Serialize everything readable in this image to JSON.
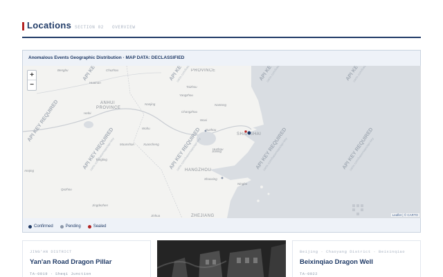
{
  "header": {
    "title": "Locations",
    "section_label": "SECTION 02",
    "section_sublabel": "OVERVIEW"
  },
  "map": {
    "caption": "Anomalous Events Geographic Distribution · MAP DATA: DECLASSIFIED",
    "zoom_in": "+",
    "zoom_out": "−",
    "watermark": "API KEY REQUIRED",
    "watermark_sub": "carto.com/basemaps/api-key",
    "attribution": "Leaflet | © CARTO",
    "place_labels": [
      {
        "text": "PROVINCE"
      },
      {
        "text": "ANHUI"
      },
      {
        "text": "PROVINCE"
      },
      {
        "text": "HANGZHOU"
      },
      {
        "text": "ZHEJIANG"
      },
      {
        "text": "SHANGHAI"
      },
      {
        "text": "Nanjing"
      },
      {
        "text": "Wuxi"
      },
      {
        "text": "Suzhou"
      },
      {
        "text": "Ningbo"
      },
      {
        "text": "Huainan"
      },
      {
        "text": "Hefei"
      },
      {
        "text": "Changzhou"
      },
      {
        "text": "Nantong"
      },
      {
        "text": "Wuhu"
      },
      {
        "text": "Jiaxing"
      },
      {
        "text": "Shaoxing"
      },
      {
        "text": "Anqing"
      },
      {
        "text": "Yangzhou"
      },
      {
        "text": "Taizhou"
      },
      {
        "text": "Bengbu"
      },
      {
        "text": "Chuzhou"
      },
      {
        "text": "Maanshan"
      },
      {
        "text": "Xuancheng"
      },
      {
        "text": "Tongling"
      },
      {
        "text": "Huzhou"
      },
      {
        "text": "Quzhou"
      },
      {
        "text": "Jingdezhen"
      },
      {
        "text": "Jinhua"
      }
    ]
  },
  "legend": [
    {
      "label": "Confirmed",
      "color": "#1f3a66"
    },
    {
      "label": "Pending",
      "color": "#8a96a8"
    },
    {
      "label": "Sealed",
      "color": "#b22222"
    }
  ],
  "cards": [
    {
      "meta": "JING'AN DISTRICT",
      "title": "Yan'an Road Dragon Pillar",
      "id": "TA-0019 · Sheqi Junction"
    },
    {
      "meta": "",
      "title": "",
      "id": ""
    },
    {
      "meta": "Beijing · Chaoyang District · Beixinqiao",
      "title": "Beixinqiao Dragon Well",
      "id": "TA-0022"
    }
  ],
  "colors": {
    "accent": "#b22222",
    "primary": "#1f3a66",
    "map_water": "#d9dde2",
    "map_land": "#f3f3f1"
  }
}
